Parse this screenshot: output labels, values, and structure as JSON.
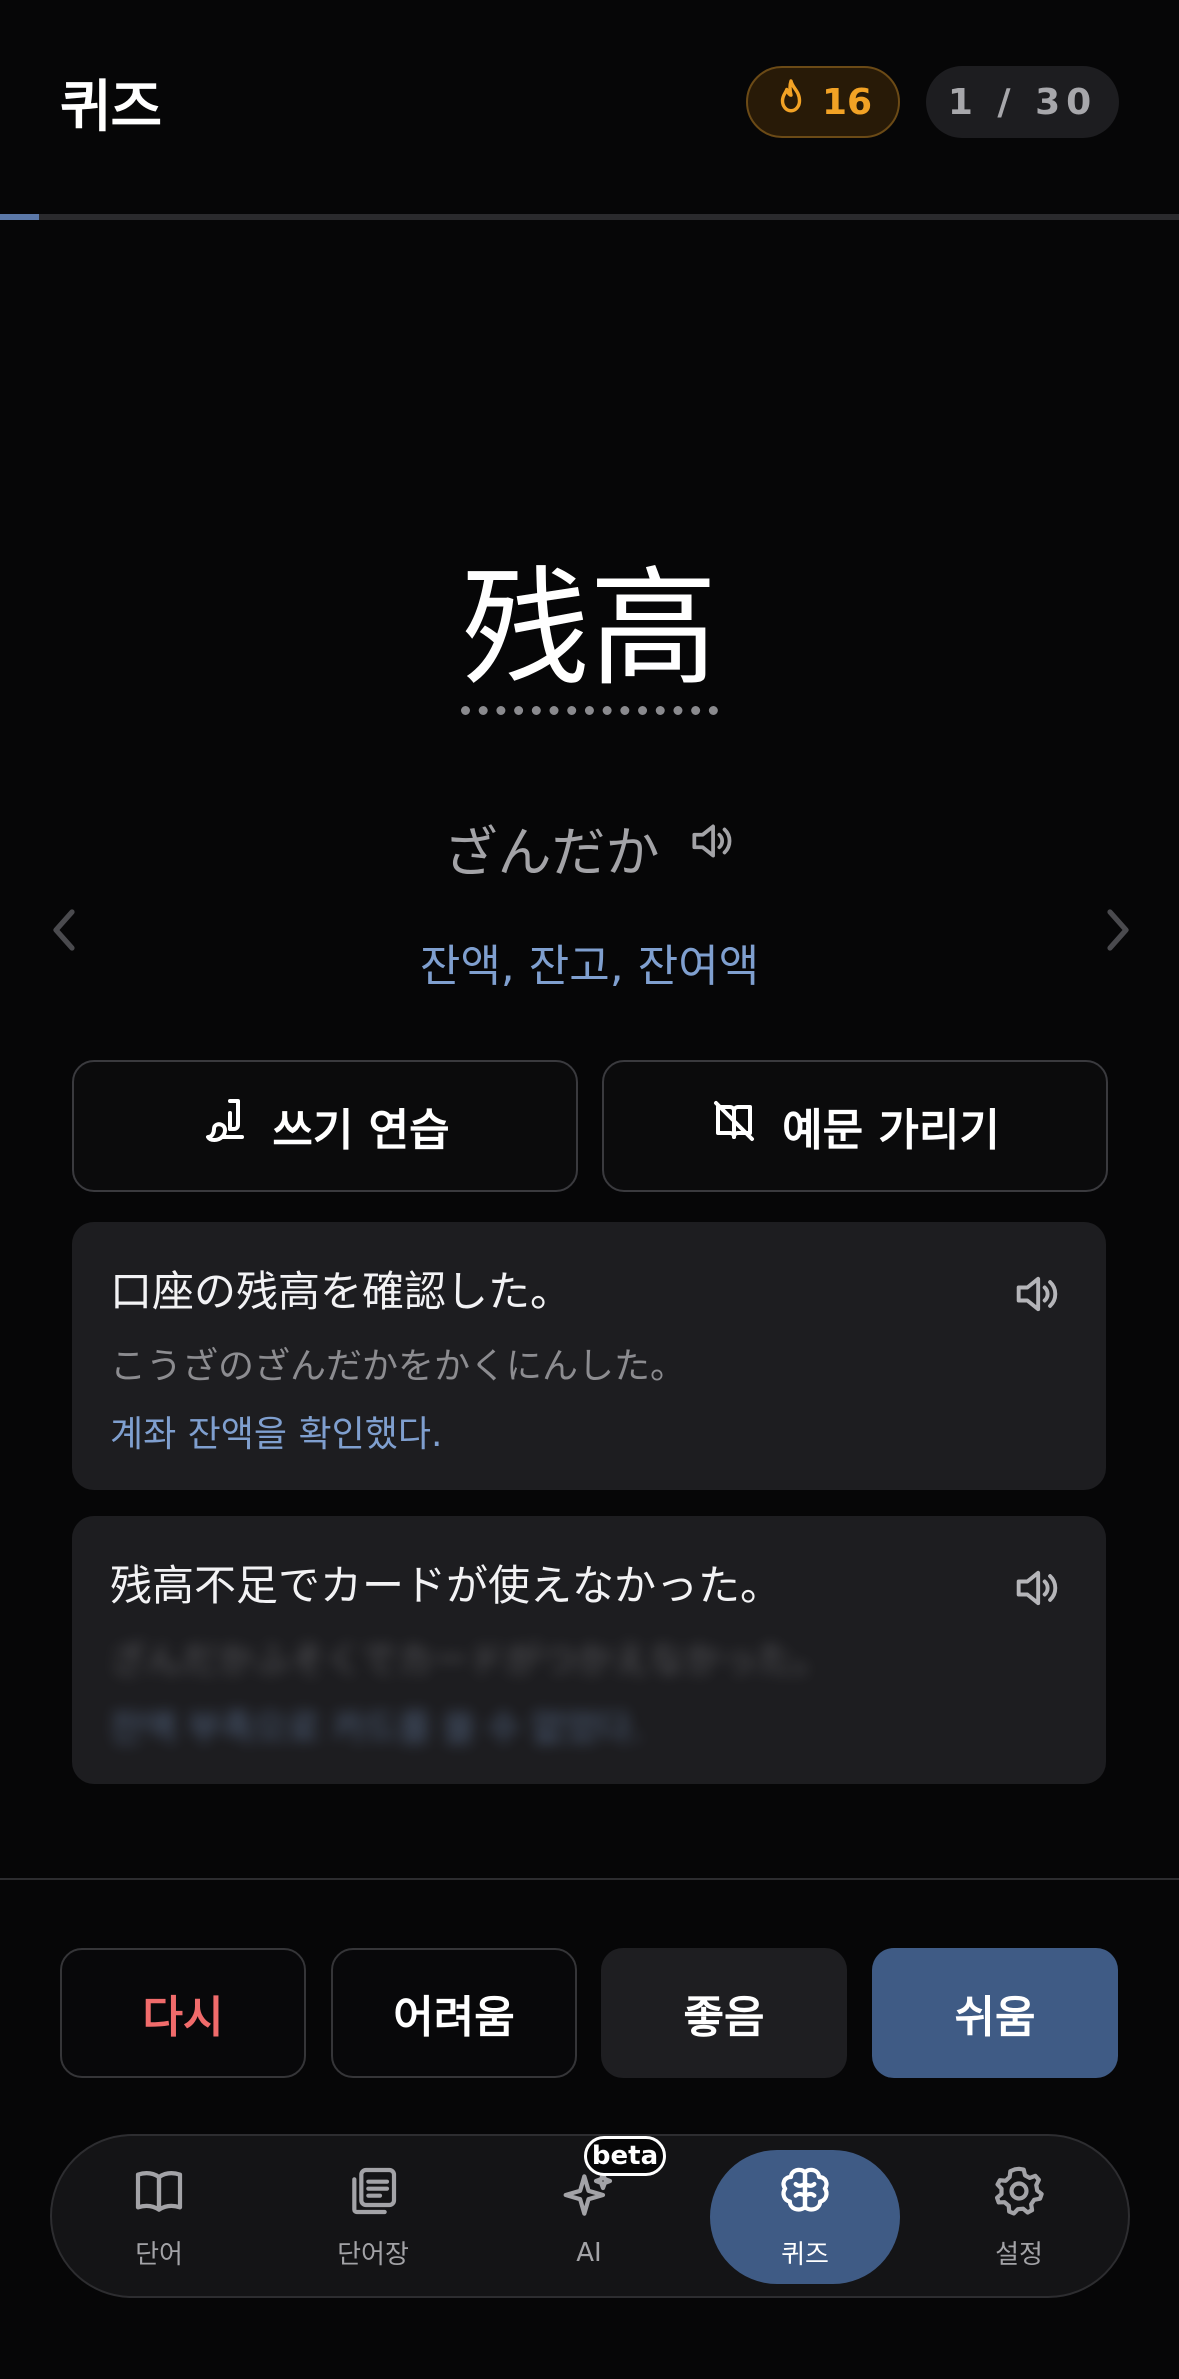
{
  "header": {
    "title": "퀴즈",
    "streak_count": "16",
    "counter": "1 / 30",
    "progress_fraction": 0.033
  },
  "word": {
    "kanji": "残高",
    "reading": "ざんだか",
    "meaning": "잔액, 잔고, 잔여액"
  },
  "actions": {
    "writing_practice": "쓰기 연습",
    "hide_examples": "예문 가리기"
  },
  "examples": [
    {
      "japanese": "口座の残高を確認した。",
      "reading": "こうざのざんだかをかくにんした。",
      "translation": "계좌 잔액을 확인했다.",
      "hidden": false
    },
    {
      "japanese": "残高不足でカードが使えなかった。",
      "reading": "ざんだかふそくでカードがつかえなかった。",
      "translation": "잔액 부족으로 카드를 쓸 수 없었다.",
      "hidden": true
    }
  ],
  "rating": {
    "again": "다시",
    "hard": "어려움",
    "good": "좋음",
    "easy": "쉬움"
  },
  "nav": {
    "items": [
      {
        "label": "단어",
        "icon": "book-icon"
      },
      {
        "label": "단어장",
        "icon": "wordbook-icon"
      },
      {
        "label": "AI",
        "icon": "sparkle-icon"
      },
      {
        "label": "퀴즈",
        "icon": "brain-icon"
      },
      {
        "label": "설정",
        "icon": "gear-icon"
      }
    ],
    "beta_label": "beta",
    "active_index": 3
  },
  "colors": {
    "accent": "#3f5b85",
    "streak": "#f2a225",
    "meaning": "#7f9fcf",
    "again": "#f06b6b"
  }
}
